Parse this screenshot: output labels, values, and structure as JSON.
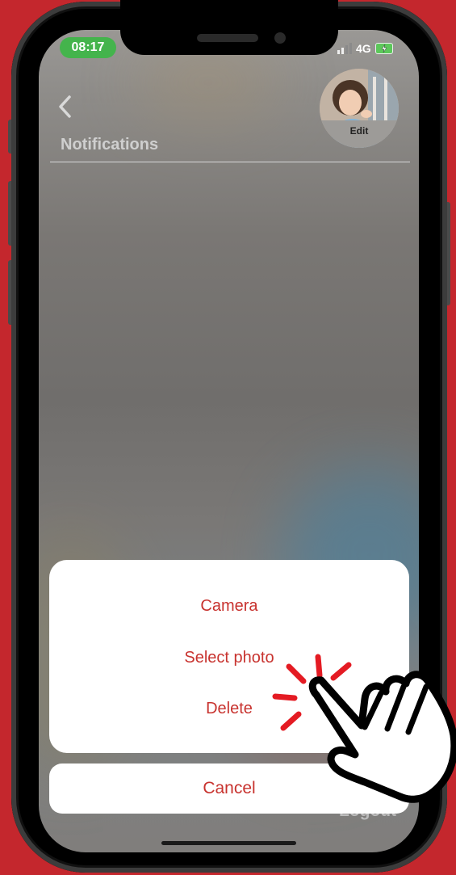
{
  "status_bar": {
    "time": "08:17",
    "network": "4G"
  },
  "header": {
    "title": "Notifications",
    "avatar_edit_label": "Edit"
  },
  "background": {
    "logout_label": "Logout"
  },
  "action_sheet": {
    "items": [
      "Camera",
      "Select photo",
      "Delete"
    ],
    "cancel_label": "Cancel"
  },
  "colors": {
    "frame_bg": "#c4272d",
    "accent": "#c8332f",
    "time_pill": "#44b44c"
  },
  "icons": [
    "back-chevron-icon",
    "signal-icon",
    "battery-charging-icon",
    "tap-hand-icon"
  ]
}
